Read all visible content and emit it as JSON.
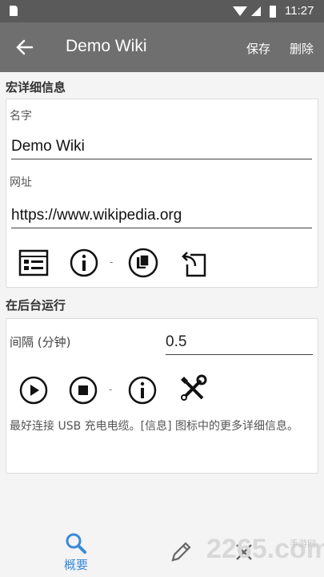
{
  "status_bar": {
    "time": "11:27"
  },
  "app_bar": {
    "title": "Demo Wiki",
    "save": "保存",
    "delete": "删除"
  },
  "section_details": {
    "title": "宏详细信息",
    "name_label": "名字",
    "name_value": "Demo Wiki",
    "url_label": "网址",
    "url_value": "https://www.wikipedia.org",
    "separator": "-"
  },
  "section_background": {
    "title": "在后台运行",
    "interval_label": "间隔 (分钟)",
    "interval_value": "0.5",
    "separator": "-",
    "info": "最好连接 USB 充电电缆。[信息] 图标中的更多详细信息。"
  },
  "bottom_nav": {
    "overview_label": "概要"
  },
  "watermark": {
    "logo": "2265.com",
    "small": "手游网"
  },
  "colors": {
    "app_bar": "#6f6f6f",
    "status_bar": "#5a5a5a",
    "accent": "#3a8ad8"
  },
  "icons": [
    "back-arrow-icon",
    "list-icon",
    "info-icon",
    "copy-icon",
    "share-icon",
    "play-icon",
    "stop-icon",
    "tools-icon",
    "search-icon",
    "pencil-icon",
    "close-icon"
  ]
}
